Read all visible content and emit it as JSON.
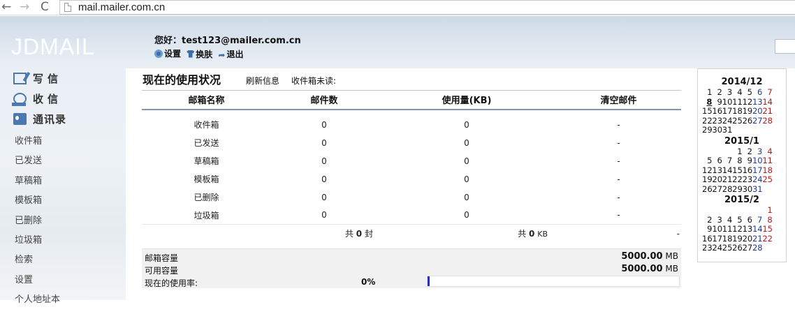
{
  "browser": {
    "url": "mail.mailer.com.cn",
    "back": "←",
    "forward": "→",
    "reload": "C"
  },
  "header": {
    "logo": "JDMAIL",
    "greeting": "您好：test123@mailer.com.cn",
    "links": [
      {
        "label": "设置",
        "icon": "gear-icon"
      },
      {
        "label": "换肤",
        "icon": "shirt-icon"
      },
      {
        "label": "退出",
        "icon": "exit-arrow-icon"
      }
    ]
  },
  "sidebar": {
    "main_items": [
      {
        "label": "写信",
        "icon": "compose-icon"
      },
      {
        "label": "收信",
        "icon": "receive-icon"
      },
      {
        "label": "通讯录",
        "icon": "contacts-icon"
      }
    ],
    "sub_items": [
      "收件箱",
      "已发送",
      "草稿箱",
      "模板箱",
      "已删除",
      "垃圾箱",
      "检索",
      "设置",
      "个人地址本"
    ]
  },
  "main": {
    "title": "现在的使用状况",
    "refresh": "刷新信息",
    "unread": "收件箱未读:",
    "columns": [
      "邮箱名称",
      "邮件数",
      "使用量(KB)",
      "清空邮件"
    ],
    "rows": [
      {
        "name": "收件箱",
        "count": "0",
        "usage": "0",
        "clear": "-"
      },
      {
        "name": "已发送",
        "count": "0",
        "usage": "0",
        "clear": "-"
      },
      {
        "name": "草稿箱",
        "count": "0",
        "usage": "0",
        "clear": "-"
      },
      {
        "name": "模板箱",
        "count": "0",
        "usage": "0",
        "clear": "-"
      },
      {
        "name": "已删除",
        "count": "0",
        "usage": "0",
        "clear": "-"
      },
      {
        "name": "垃圾箱",
        "count": "0",
        "usage": "0",
        "clear": "-"
      }
    ],
    "total": {
      "count_prefix": "共",
      "count": "0",
      "count_unit": "封",
      "usage_prefix": "共",
      "usage": "0",
      "usage_unit": "KB",
      "clear": "-"
    },
    "capacity": {
      "mailbox_label": "邮箱容量",
      "mailbox_value": "5000.00",
      "available_label": "可用容量",
      "available_value": "5000.00",
      "unit": "MB",
      "rate_label": "现在的使用率:",
      "rate_text": "0%",
      "rate_fill_fraction": 0.006,
      "bar_color": "#2a2fc4"
    }
  },
  "calendar": {
    "months": [
      {
        "title": "2014/12",
        "offset": 0,
        "days": 31,
        "today": 8
      },
      {
        "title": "2015/1",
        "offset": 3,
        "days": 31,
        "today": null
      },
      {
        "title": "2015/2",
        "offset": 6,
        "days": 28,
        "today": null
      }
    ],
    "saturday_color": "#1e3a9c",
    "sunday_color": "#b01a1a"
  }
}
